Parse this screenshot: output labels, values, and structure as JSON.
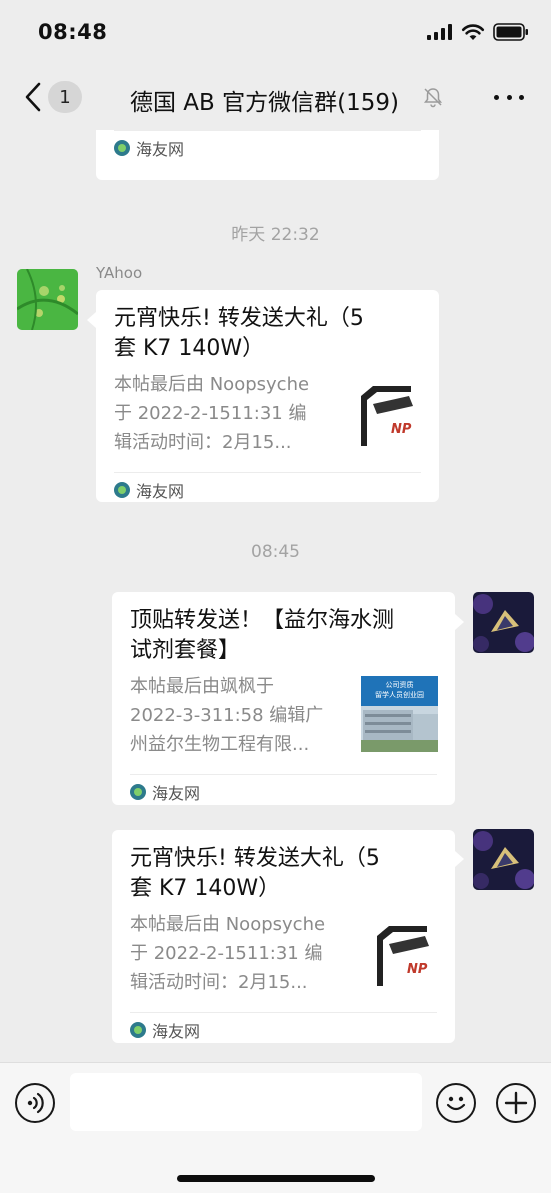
{
  "status_bar": {
    "time": "08:48",
    "icons": [
      "signal-icon",
      "wifi-icon",
      "battery-icon"
    ]
  },
  "nav": {
    "back_icon": "chevron-left-icon",
    "unread_count": "1",
    "title": "德国 AB  官方微信群(159)",
    "mute_icon": "bell-off-icon",
    "more_icon": "more-dots-icon"
  },
  "messages": [
    {
      "source": "海友网"
    },
    {
      "time": "昨天 22:32",
      "sender": "YAhoo",
      "title_line1": "元宵快乐! 转发送大礼（5",
      "title_line2": "套 K7  140W）",
      "desc_line1": "本帖最后由 Noopsyche",
      "desc_line2": "于 2022-2-1511:31 编",
      "desc_line3": "辑活动时间：2月15...",
      "thumb_text": "NP",
      "source": "海友网"
    },
    {
      "time": "08:45",
      "title_line1": "顶贴转发送！【益尔海水测",
      "title_line2": "试剂套餐】",
      "desc_line1": "本帖最后由飒枫于",
      "desc_line2": "2022-3-311:58 编辑广",
      "desc_line3": "州益尔生物工程有限...",
      "thumb_text_1": "公司资质",
      "thumb_text_2": "留学人员创业园",
      "source": "海友网"
    },
    {
      "title_line1": "元宵快乐! 转发送大礼（5",
      "title_line2": "套 K7  140W）",
      "desc_line1": "本帖最后由 Noopsyche",
      "desc_line2": "于 2022-2-1511:31 编",
      "desc_line3": "辑活动时间：2月15...",
      "thumb_text": "NP",
      "source": "海友网"
    }
  ],
  "input_bar": {
    "voice_icon": "voice-icon",
    "message_value": "",
    "emoji_icon": "emoji-icon",
    "plus_icon": "plus-icon"
  },
  "colors": {
    "background": "#ededed",
    "bubble": "#ffffff",
    "secondary_text": "#8a8a8a"
  }
}
